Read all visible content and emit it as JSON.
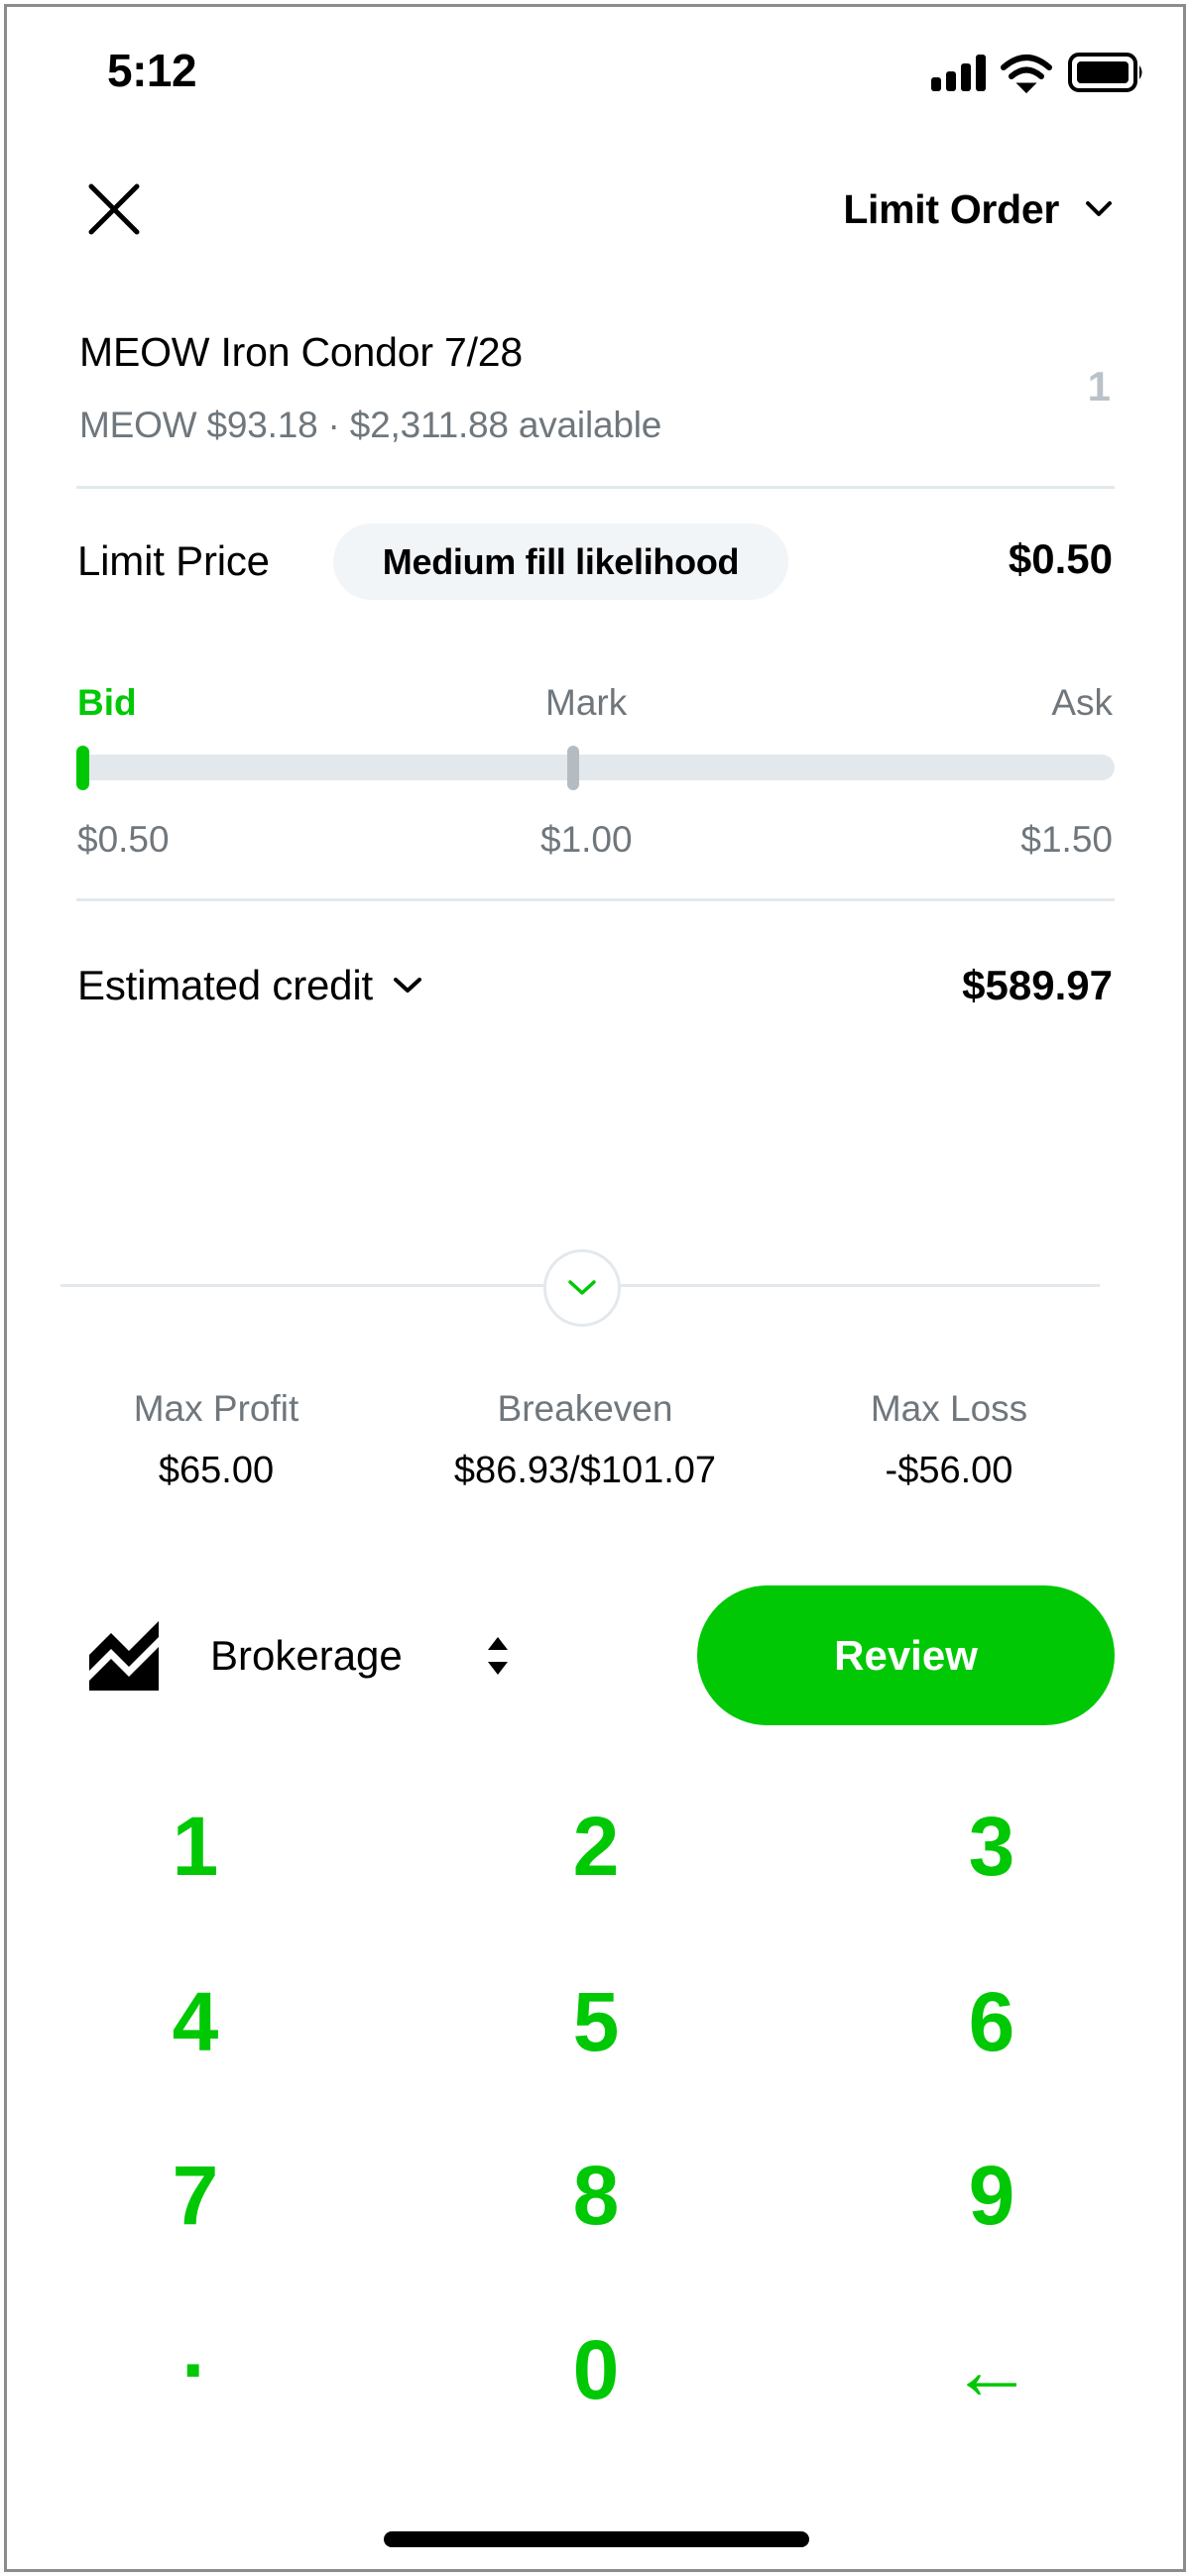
{
  "status_bar": {
    "time": "5:12",
    "icons": [
      "cellular-signal-icon",
      "wifi-icon",
      "battery-icon"
    ]
  },
  "header": {
    "close_icon": "close-icon",
    "order_type": "Limit Order",
    "order_type_icon": "chevron-down-icon"
  },
  "instrument": {
    "title": "MEOW Iron Condor 7/28",
    "subtitle": "MEOW $93.18 · $2,311.88 available",
    "quantity": "1"
  },
  "limit_price": {
    "label": "Limit Price",
    "fill_likelihood": "Medium fill likelihood",
    "value": "$0.50"
  },
  "price_slider": {
    "labels": {
      "bid": "Bid",
      "mark": "Mark",
      "ask": "Ask"
    },
    "prices": {
      "bid": "$0.50",
      "mark": "$1.00",
      "ask": "$1.50"
    },
    "selected_position": 0.0,
    "mark_position": 0.5
  },
  "estimate": {
    "label": "Estimated credit",
    "value": "$589.97",
    "icon": "chevron-down-icon"
  },
  "expand": {
    "icon": "chevron-down-icon"
  },
  "stats": [
    {
      "label": "Max Profit",
      "value": "$65.00"
    },
    {
      "label": "Breakeven",
      "value": "$86.93/$101.07"
    },
    {
      "label": "Max Loss",
      "value": "-$56.00"
    }
  ],
  "account": {
    "icon": "brokerage-chart-icon",
    "label": "Brokerage",
    "selector_icon": "up-down-arrows-icon"
  },
  "review_button": "Review",
  "keypad": {
    "keys": [
      "1",
      "2",
      "3",
      "4",
      "5",
      "6",
      "7",
      "8",
      "9",
      "·",
      "0",
      "←"
    ]
  },
  "colors": {
    "accent_green": "#00c805",
    "muted_text": "#6f777d",
    "divider": "#e3e8ec",
    "pill_bg": "#f2f5f8",
    "mark_handle": "#b4bcc2",
    "quantity_placeholder": "#b9c2c8"
  }
}
